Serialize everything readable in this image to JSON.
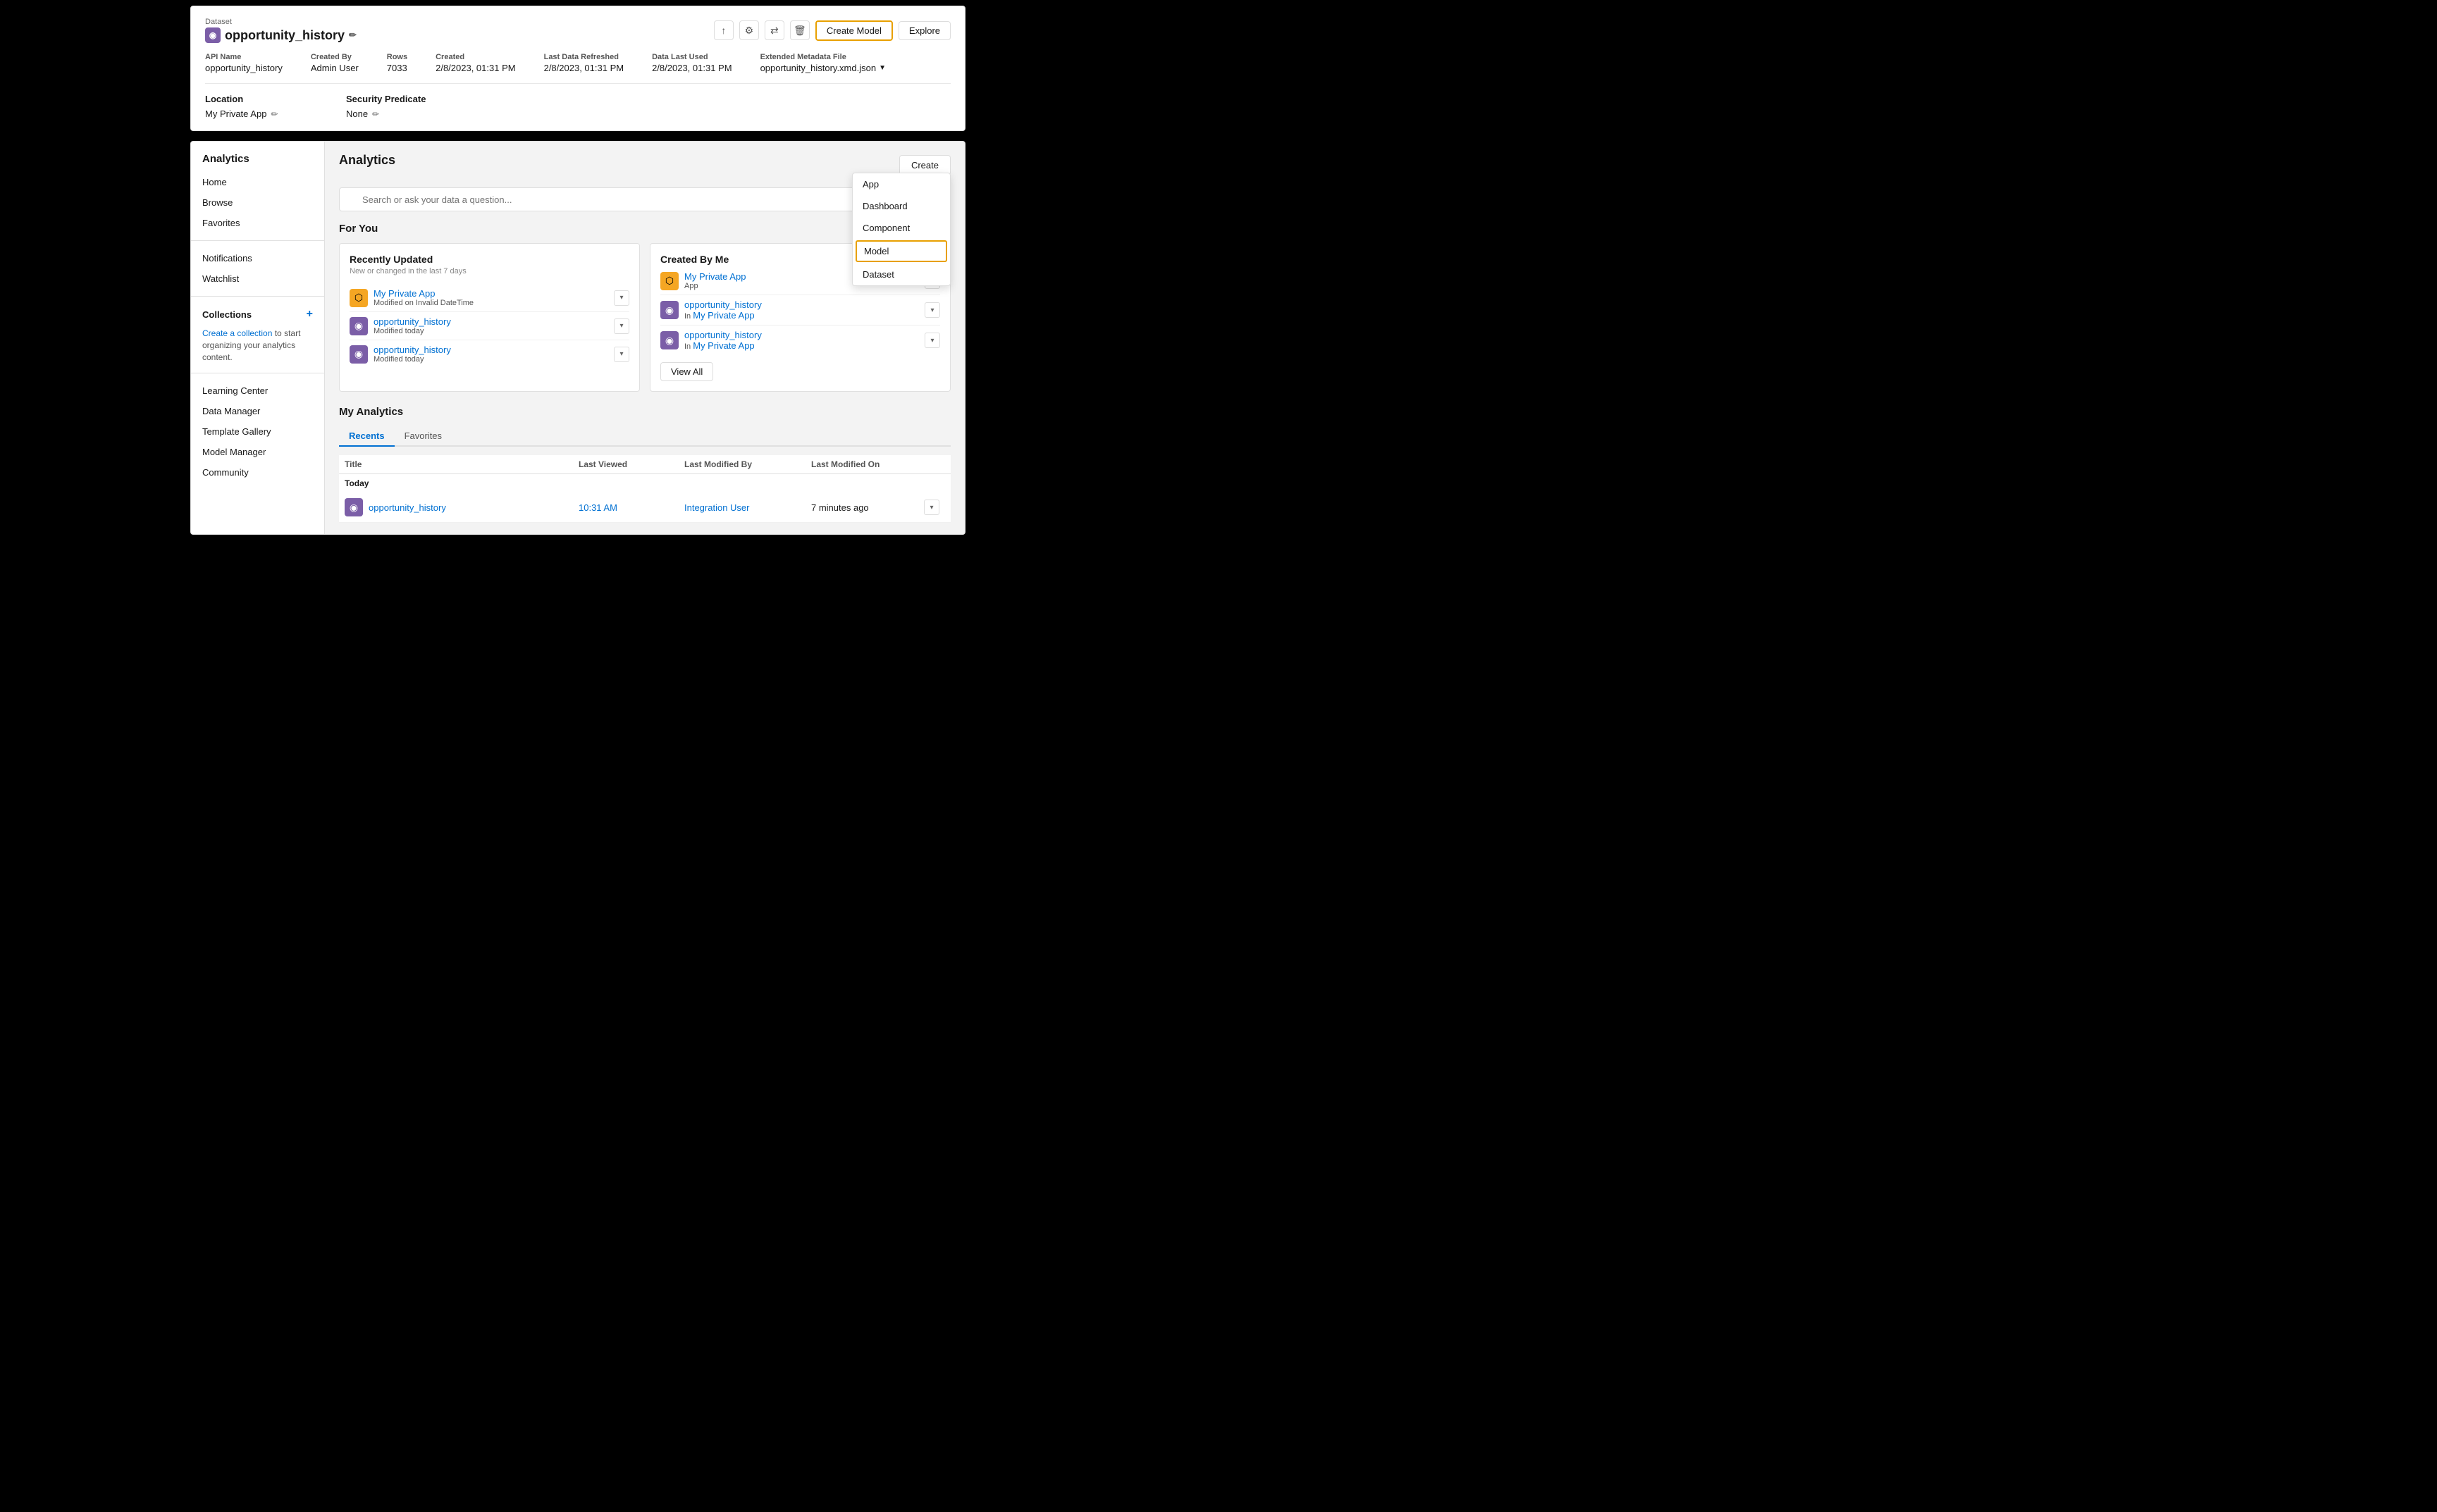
{
  "topPanel": {
    "datasetLabel": "Dataset",
    "datasetName": "opportunity_history",
    "buttons": {
      "createModel": "Create Model",
      "explore": "Explore"
    },
    "meta": [
      {
        "label": "API Name",
        "value": "opportunity_history"
      },
      {
        "label": "Created By",
        "value": "Admin User"
      },
      {
        "label": "Rows",
        "value": "7033"
      },
      {
        "label": "Created",
        "value": "2/8/2023, 01:31 PM"
      },
      {
        "label": "Last Data Refreshed",
        "value": "2/8/2023, 01:31 PM"
      },
      {
        "label": "Data Last Used",
        "value": "2/8/2023, 01:31 PM"
      },
      {
        "label": "Extended Metadata File",
        "value": "opportunity_history.xmd.json"
      }
    ],
    "location": {
      "heading": "Location",
      "value": "My Private App"
    },
    "security": {
      "heading": "Security Predicate",
      "value": "None"
    }
  },
  "sidebar": {
    "title": "Analytics",
    "navItems": [
      {
        "label": "Home"
      },
      {
        "label": "Browse"
      },
      {
        "label": "Favorites"
      }
    ],
    "secondaryItems": [
      {
        "label": "Notifications"
      },
      {
        "label": "Watchlist"
      }
    ],
    "collectionsTitle": "Collections",
    "collectionsLinkText": "Create a collection",
    "collectionsBodyText": " to start organizing your analytics content.",
    "bottomItems": [
      {
        "label": "Learning Center"
      },
      {
        "label": "Data Manager"
      },
      {
        "label": "Template Gallery"
      },
      {
        "label": "Model Manager"
      },
      {
        "label": "Community"
      }
    ]
  },
  "main": {
    "title": "Analytics",
    "searchPlaceholder": "Search or ask your data a question...",
    "createButton": "Create",
    "dropdown": {
      "items": [
        "App",
        "Dashboard",
        "Component",
        "Model",
        "Dataset"
      ],
      "activeItem": "Model"
    },
    "forYou": {
      "title": "For You",
      "recentlyUpdated": {
        "title": "Recently Updated",
        "subtitle": "New or changed in the last 7 days",
        "items": [
          {
            "name": "My Private App",
            "sub": "Modified on Invalid DateTime",
            "iconType": "orange"
          },
          {
            "name": "opportunity_history",
            "sub": "Modified today",
            "iconType": "purple"
          },
          {
            "name": "opportunity_history",
            "sub": "Modified today",
            "iconType": "purple"
          }
        ]
      },
      "createdByMe": {
        "title": "Created By Me",
        "items": [
          {
            "name": "My Private App",
            "sub": "App",
            "iconType": "orange"
          },
          {
            "name": "opportunity_history",
            "sub": "In My Private App",
            "iconType": "purple"
          },
          {
            "name": "opportunity_history",
            "sub": "In My Private App",
            "iconType": "purple"
          }
        ],
        "viewAll": "View All"
      }
    },
    "myAnalytics": {
      "title": "My Analytics",
      "tabs": [
        "Recents",
        "Favorites"
      ],
      "activeTab": "Recents",
      "tableHeaders": [
        "Title",
        "Last Viewed",
        "Last Modified By",
        "Last Modified On"
      ],
      "groups": [
        {
          "groupLabel": "Today",
          "rows": [
            {
              "name": "opportunity_history",
              "iconType": "purple",
              "lastViewed": "10:31 AM",
              "lastModifiedBy": "Integration User",
              "lastModifiedOn": "7 minutes ago"
            }
          ]
        }
      ]
    }
  }
}
